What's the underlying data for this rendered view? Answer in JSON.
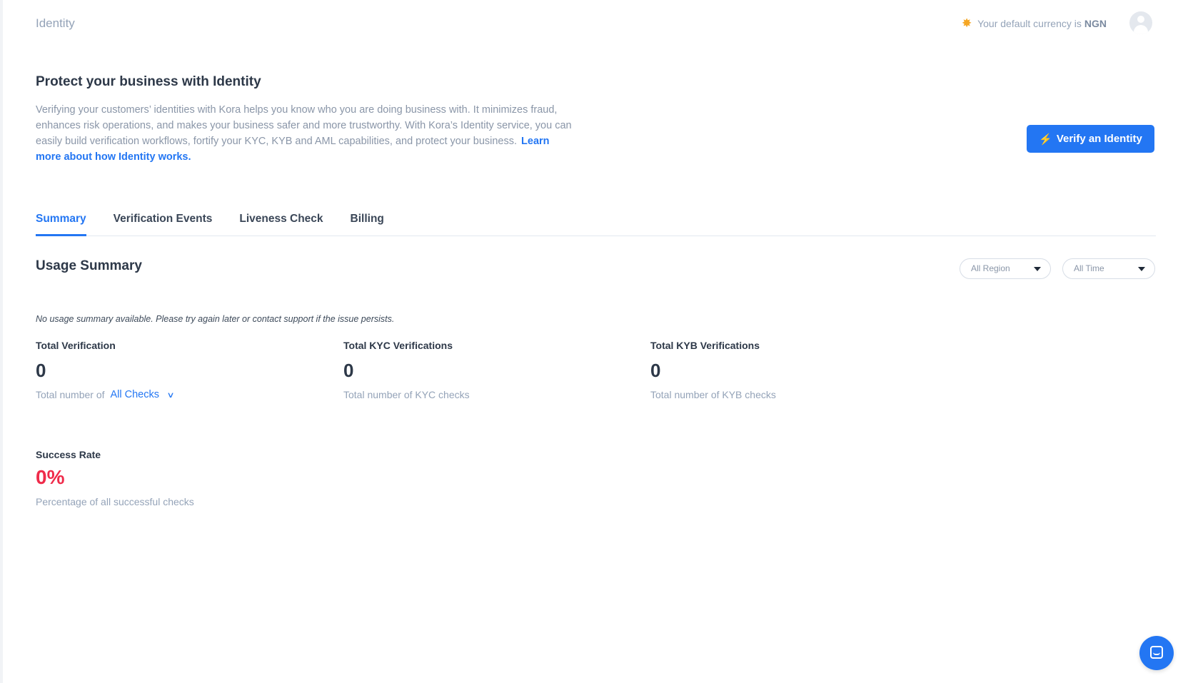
{
  "header": {
    "page_title": "Identity",
    "currency_text": "Your default currency is",
    "currency_code": "NGN",
    "icons": {
      "currency": "sun-badge-icon",
      "avatar": "user-avatar-icon"
    }
  },
  "hero": {
    "title": "Protect your business with Identity",
    "description": "Verifying your customers’ identities with Kora helps you know who you are doing business with. It minimizes fraud, enhances risk operations, and makes your business safer and more trustworthy. With Kora’s Identity service, you can easily build verification workflows, fortify your KYC, KYB and AML capabilities, and protect your business.",
    "learn_more": "Learn more about how Identity works.",
    "verify_button": "Verify an Identity"
  },
  "tabs": [
    {
      "label": "Summary",
      "active": true
    },
    {
      "label": "Verification Events",
      "active": false
    },
    {
      "label": "Liveness Check",
      "active": false
    },
    {
      "label": "Billing",
      "active": false
    }
  ],
  "usage": {
    "title": "Usage Summary",
    "region_select": "All Region",
    "time_select": "All Time",
    "notice": "No usage summary available. Please try again later or contact support if the issue persists.",
    "stats": [
      {
        "label": "Total Verification",
        "value": "0",
        "sub": "Total number of",
        "link": "All Checks"
      },
      {
        "label": "Total KYC Verifications",
        "value": "0",
        "sub": "Total number of KYC checks"
      },
      {
        "label": "Total KYB Verifications",
        "value": "0",
        "sub": "Total number of KYB checks"
      }
    ],
    "success_rate": {
      "label": "Success Rate",
      "value": "0%",
      "sub": "Percentage of all successful checks"
    }
  },
  "colors": {
    "accent": "#2376f3",
    "danger": "#ef2b4a",
    "muted": "#94a3b8",
    "heading": "#2d3848"
  }
}
